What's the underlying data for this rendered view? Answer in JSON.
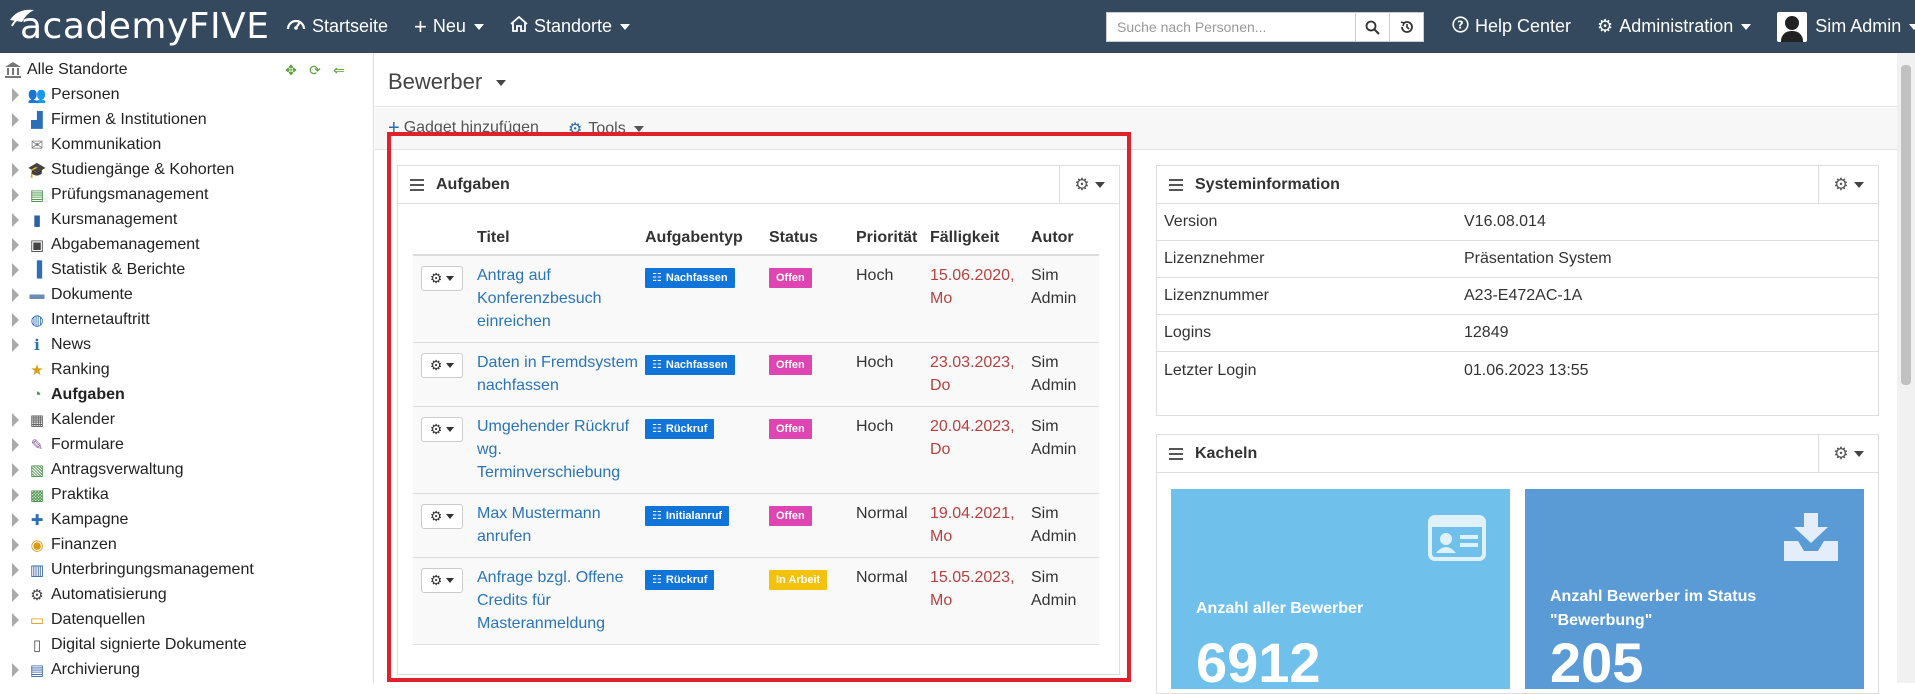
{
  "topbar": {
    "brand": "academyFIVE",
    "nav": {
      "home": "Startseite",
      "new": "Neu",
      "locations": "Standorte"
    },
    "search_placeholder": "Suche nach Personen...",
    "help": "Help Center",
    "admin": "Administration",
    "user": "Sim Admin"
  },
  "sidebar": {
    "root": "Alle Standorte",
    "items": [
      {
        "label": "Personen",
        "icon": "people-icon"
      },
      {
        "label": "Firmen & Institutionen",
        "icon": "factory-icon"
      },
      {
        "label": "Kommunikation",
        "icon": "envelope-icon"
      },
      {
        "label": "Studiengänge & Kohorten",
        "icon": "graduation-icon"
      },
      {
        "label": "Prüfungsmanagement",
        "icon": "exam-icon"
      },
      {
        "label": "Kursmanagement",
        "icon": "book-icon"
      },
      {
        "label": "Abgabemanagement",
        "icon": "submission-icon"
      },
      {
        "label": "Statistik & Berichte",
        "icon": "chart-icon"
      },
      {
        "label": "Dokumente",
        "icon": "folder-icon"
      },
      {
        "label": "Internetauftritt",
        "icon": "globe-icon"
      },
      {
        "label": "News",
        "icon": "info-icon"
      },
      {
        "label": "Ranking",
        "icon": "ranking-icon"
      },
      {
        "label": "Aufgaben",
        "icon": "tasks-icon"
      },
      {
        "label": "Kalender",
        "icon": "calendar-icon"
      },
      {
        "label": "Formulare",
        "icon": "form-icon"
      },
      {
        "label": "Antragsverwaltung",
        "icon": "application-icon"
      },
      {
        "label": "Praktika",
        "icon": "internship-icon"
      },
      {
        "label": "Kampagne",
        "icon": "campaign-icon"
      },
      {
        "label": "Finanzen",
        "icon": "coins-icon"
      },
      {
        "label": "Unterbringungsmanagement",
        "icon": "building-icon"
      },
      {
        "label": "Automatisierung",
        "icon": "gear-icon"
      },
      {
        "label": "Datenquellen",
        "icon": "database-icon"
      },
      {
        "label": "Digital signierte Dokumente",
        "icon": "signed-doc-icon"
      },
      {
        "label": "Archivierung",
        "icon": "archive-icon"
      }
    ]
  },
  "page": {
    "title": "Bewerber",
    "add_gadget": "Gadget hinzufügen",
    "tools": "Tools"
  },
  "tasks": {
    "title": "Aufgaben",
    "columns": [
      "Titel",
      "Aufgabentyp",
      "Status",
      "Priorität",
      "Fälligkeit",
      "Autor"
    ],
    "rows": [
      {
        "title": "Antrag auf Konferenzbesuch einreichen",
        "type": "Nachfassen",
        "status": "Offen",
        "status_color": "#de45b2",
        "priority": "Hoch",
        "due": "15.06.2020, Mo",
        "author": "Sim Admin"
      },
      {
        "title": "Daten in Fremdsystem nachfassen",
        "type": "Nachfassen",
        "status": "Offen",
        "status_color": "#de45b2",
        "priority": "Hoch",
        "due": "23.03.2023, Do",
        "author": "Sim Admin"
      },
      {
        "title": "Umgehender Rückruf wg. Terminverschiebung",
        "type": "Rückruf",
        "status": "Offen",
        "status_color": "#de45b2",
        "priority": "Hoch",
        "due": "20.04.2023, Do",
        "author": "Sim Admin"
      },
      {
        "title": "Max Mustermann anrufen",
        "type": "Initialanruf",
        "status": "Offen",
        "status_color": "#de45b2",
        "priority": "Normal",
        "due": "19.04.2021, Mo",
        "author": "Sim Admin"
      },
      {
        "title": "Anfrage bzgl. Offene Credits für Masteranmeldung",
        "type": "Rückruf",
        "status": "In Arbeit",
        "status_color": "#f2c20c",
        "priority": "Normal",
        "due": "15.05.2023, Mo",
        "author": "Sim Admin"
      }
    ]
  },
  "sysinfo": {
    "title": "Systeminformation",
    "rows": [
      {
        "key": "Version",
        "value": "V16.08.014"
      },
      {
        "key": "Lizenznehmer",
        "value": "Präsentation System"
      },
      {
        "key": "Lizenznummer",
        "value": "A23-E472AC-1A"
      },
      {
        "key": "Logins",
        "value": "12849"
      },
      {
        "key": "Letzter Login",
        "value": "01.06.2023 13:55"
      }
    ]
  },
  "tiles": {
    "title": "Kacheln",
    "items": [
      {
        "label": "Anzahl aller Bewerber",
        "value": "6912",
        "color": "#6fc1ec"
      },
      {
        "label": "Anzahl Bewerber im Status \"Bewerbung\"",
        "value": "205",
        "color": "#5a9bd6"
      }
    ]
  },
  "colors": {
    "topbar": "#34495e",
    "link": "#2a74b8",
    "highlight": "#e0202a",
    "due": "#b5413f"
  }
}
